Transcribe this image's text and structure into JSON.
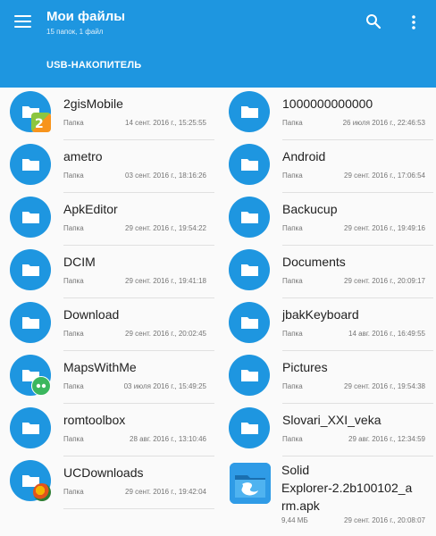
{
  "appbar": {
    "title": "Мои файлы",
    "subtitle": "15 папок, 1 файл",
    "location": "USB-НАКОПИТЕЛЬ",
    "menu_icon": "hamburger-menu-icon",
    "search_icon": "search-icon",
    "more_icon": "more-vert-icon",
    "color": "#1e96e0"
  },
  "items": [
    {
      "name": "2gisMobile",
      "type": "Папка",
      "date": "14 сент. 2016 г., 15:25:55",
      "badge": "2gis-badge"
    },
    {
      "name": "1000000000000",
      "type": "Папка",
      "date": "26 июля 2016 г., 22:46:53"
    },
    {
      "name": "ametro",
      "type": "Папка",
      "date": "03 сент. 2016 г., 18:16:26"
    },
    {
      "name": "Android",
      "type": "Папка",
      "date": "29 сент. 2016 г., 17:06:54"
    },
    {
      "name": "ApkEditor",
      "type": "Папка",
      "date": "29 сент. 2016 г., 19:54:22"
    },
    {
      "name": "Backucup",
      "type": "Папка",
      "date": "29 сент. 2016 г., 19:49:16"
    },
    {
      "name": "DCIM",
      "type": "Папка",
      "date": "29 сент. 2016 г., 19:41:18"
    },
    {
      "name": "Documents",
      "type": "Папка",
      "date": "29 сент. 2016 г., 20:09:17"
    },
    {
      "name": "Download",
      "type": "Папка",
      "date": "29 сент. 2016 г., 20:02:45"
    },
    {
      "name": "jbakKeyboard",
      "type": "Папка",
      "date": "14 авг. 2016 г., 16:49:55"
    },
    {
      "name": "MapsWithMe",
      "type": "Папка",
      "date": "03 июля 2016 г., 15:49:25",
      "badge": "maps-badge"
    },
    {
      "name": "Pictures",
      "type": "Папка",
      "date": "29 сент. 2016 г., 19:54:38"
    },
    {
      "name": "romtoolbox",
      "type": "Папка",
      "date": "28 авг. 2016 г., 13:10:46"
    },
    {
      "name": "Slovari_XXI_veka",
      "type": "Папка",
      "date": "29 авг. 2016 г., 12:34:59"
    },
    {
      "name": "UCDownloads",
      "type": "Папка",
      "date": "29 сент. 2016 г., 19:42:04",
      "badge": "uc-badge"
    }
  ],
  "apk": {
    "name_line1": "Solid",
    "name_line2": "Explorer-2.2b100102_a",
    "name_line3": "rm.apk",
    "size": "9,44 МБ",
    "date": "29 сент. 2016 г., 20:08:07",
    "icon": "solid-explorer-app-icon"
  }
}
